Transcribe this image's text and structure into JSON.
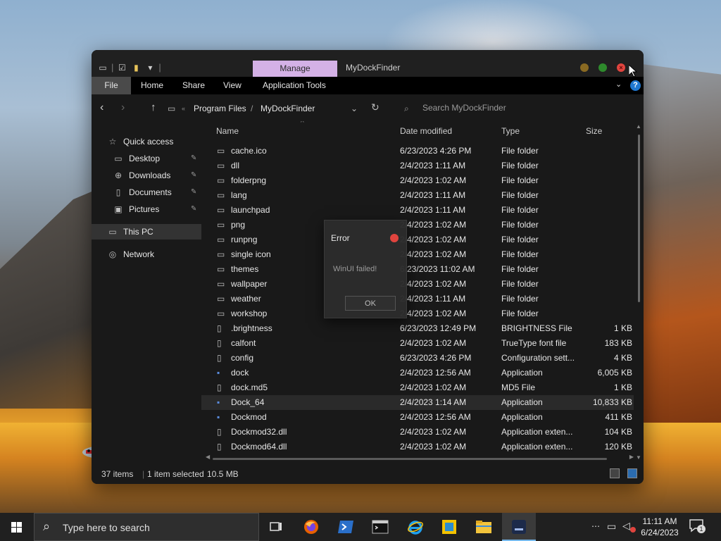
{
  "window": {
    "title": "MyDockFinder",
    "manage_tab": "Manage",
    "ribbon_tabs": [
      "File",
      "Home",
      "Share",
      "View",
      "Application Tools"
    ],
    "help": "?"
  },
  "address": {
    "crumbs": [
      "Program Files",
      "MyDockFinder"
    ],
    "search_placeholder": "Search MyDockFinder"
  },
  "sidebar": {
    "items": [
      {
        "label": "Quick access",
        "icon": "star-icon"
      },
      {
        "label": "Desktop",
        "icon": "desktop-icon",
        "pinned": true
      },
      {
        "label": "Downloads",
        "icon": "download-icon",
        "pinned": true
      },
      {
        "label": "Documents",
        "icon": "document-icon",
        "pinned": true
      },
      {
        "label": "Pictures",
        "icon": "picture-icon",
        "pinned": true
      },
      {
        "label": "This PC",
        "icon": "computer-icon"
      },
      {
        "label": "Network",
        "icon": "network-icon"
      }
    ]
  },
  "columns": {
    "name": "Name",
    "date": "Date modified",
    "type": "Type",
    "size": "Size"
  },
  "files": [
    {
      "name": "cache.ico",
      "date": "6/23/2023 4:26 PM",
      "type": "File folder",
      "size": ""
    },
    {
      "name": "dll",
      "date": "2/4/2023 1:11 AM",
      "type": "File folder",
      "size": ""
    },
    {
      "name": "folderpng",
      "date": "2/4/2023 1:02 AM",
      "type": "File folder",
      "size": ""
    },
    {
      "name": "lang",
      "date": "2/4/2023 1:11 AM",
      "type": "File folder",
      "size": ""
    },
    {
      "name": "launchpad",
      "date": "2/4/2023 1:11 AM",
      "type": "File folder",
      "size": ""
    },
    {
      "name": "png",
      "date": "2/4/2023 1:02 AM",
      "type": "File folder",
      "size": ""
    },
    {
      "name": "runpng",
      "date": "2/4/2023 1:02 AM",
      "type": "File folder",
      "size": ""
    },
    {
      "name": "single icon",
      "date": "2/4/2023 1:02 AM",
      "type": "File folder",
      "size": ""
    },
    {
      "name": "themes",
      "date": "6/23/2023 11:02 AM",
      "type": "File folder",
      "size": ""
    },
    {
      "name": "wallpaper",
      "date": "2/4/2023 1:02 AM",
      "type": "File folder",
      "size": ""
    },
    {
      "name": "weather",
      "date": "2/4/2023 1:11 AM",
      "type": "File folder",
      "size": ""
    },
    {
      "name": "workshop",
      "date": "2/4/2023 1:02 AM",
      "type": "File folder",
      "size": ""
    },
    {
      "name": ".brightness",
      "date": "6/23/2023 12:49 PM",
      "type": "BRIGHTNESS File",
      "size": "1 KB"
    },
    {
      "name": "calfont",
      "date": "2/4/2023 1:02 AM",
      "type": "TrueType font file",
      "size": "183 KB"
    },
    {
      "name": "config",
      "date": "6/23/2023 4:26 PM",
      "type": "Configuration sett...",
      "size": "4 KB"
    },
    {
      "name": "dock",
      "date": "2/4/2023 12:56 AM",
      "type": "Application",
      "size": "6,005 KB"
    },
    {
      "name": "dock.md5",
      "date": "2/4/2023 1:02 AM",
      "type": "MD5 File",
      "size": "1 KB"
    },
    {
      "name": "Dock_64",
      "date": "2/4/2023 1:14 AM",
      "type": "Application",
      "size": "10,833 KB"
    },
    {
      "name": "Dockmod",
      "date": "2/4/2023 12:56 AM",
      "type": "Application",
      "size": "411 KB"
    },
    {
      "name": "Dockmod32.dll",
      "date": "2/4/2023 1:02 AM",
      "type": "Application exten...",
      "size": "104 KB"
    },
    {
      "name": "Dockmod64.dll",
      "date": "2/4/2023 1:02 AM",
      "type": "Application exten...",
      "size": "120 KB"
    }
  ],
  "selected_file": "Dock_64",
  "status": {
    "items": "37 items",
    "selected": "1 item selected",
    "size": "10.5 MB"
  },
  "dialog": {
    "title": "Error",
    "message": "WinUI failed!",
    "ok_label": "OK"
  },
  "taskbar": {
    "search_placeholder": "Type here to search",
    "time": "11:11 AM",
    "date": "6/24/2023",
    "notification_count": "1"
  }
}
